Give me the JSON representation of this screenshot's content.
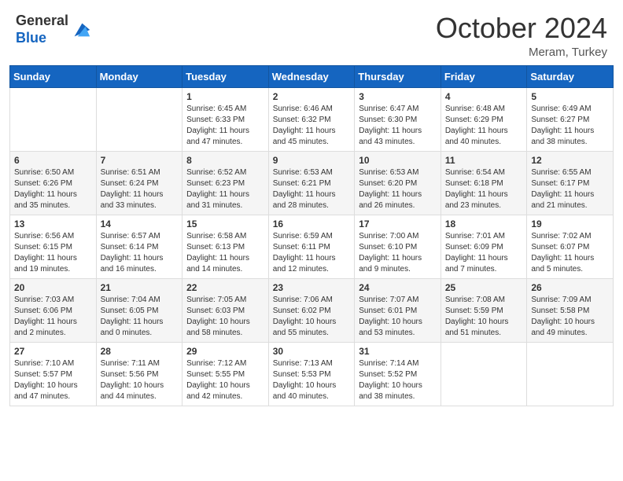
{
  "logo": {
    "line1": "General",
    "line2": "Blue"
  },
  "header": {
    "month": "October 2024",
    "location": "Meram, Turkey"
  },
  "weekdays": [
    "Sunday",
    "Monday",
    "Tuesday",
    "Wednesday",
    "Thursday",
    "Friday",
    "Saturday"
  ],
  "weeks": [
    [
      {
        "day": "",
        "info": ""
      },
      {
        "day": "",
        "info": ""
      },
      {
        "day": "1",
        "info": "Sunrise: 6:45 AM\nSunset: 6:33 PM\nDaylight: 11 hours and 47 minutes."
      },
      {
        "day": "2",
        "info": "Sunrise: 6:46 AM\nSunset: 6:32 PM\nDaylight: 11 hours and 45 minutes."
      },
      {
        "day": "3",
        "info": "Sunrise: 6:47 AM\nSunset: 6:30 PM\nDaylight: 11 hours and 43 minutes."
      },
      {
        "day": "4",
        "info": "Sunrise: 6:48 AM\nSunset: 6:29 PM\nDaylight: 11 hours and 40 minutes."
      },
      {
        "day": "5",
        "info": "Sunrise: 6:49 AM\nSunset: 6:27 PM\nDaylight: 11 hours and 38 minutes."
      }
    ],
    [
      {
        "day": "6",
        "info": "Sunrise: 6:50 AM\nSunset: 6:26 PM\nDaylight: 11 hours and 35 minutes."
      },
      {
        "day": "7",
        "info": "Sunrise: 6:51 AM\nSunset: 6:24 PM\nDaylight: 11 hours and 33 minutes."
      },
      {
        "day": "8",
        "info": "Sunrise: 6:52 AM\nSunset: 6:23 PM\nDaylight: 11 hours and 31 minutes."
      },
      {
        "day": "9",
        "info": "Sunrise: 6:53 AM\nSunset: 6:21 PM\nDaylight: 11 hours and 28 minutes."
      },
      {
        "day": "10",
        "info": "Sunrise: 6:53 AM\nSunset: 6:20 PM\nDaylight: 11 hours and 26 minutes."
      },
      {
        "day": "11",
        "info": "Sunrise: 6:54 AM\nSunset: 6:18 PM\nDaylight: 11 hours and 23 minutes."
      },
      {
        "day": "12",
        "info": "Sunrise: 6:55 AM\nSunset: 6:17 PM\nDaylight: 11 hours and 21 minutes."
      }
    ],
    [
      {
        "day": "13",
        "info": "Sunrise: 6:56 AM\nSunset: 6:15 PM\nDaylight: 11 hours and 19 minutes."
      },
      {
        "day": "14",
        "info": "Sunrise: 6:57 AM\nSunset: 6:14 PM\nDaylight: 11 hours and 16 minutes."
      },
      {
        "day": "15",
        "info": "Sunrise: 6:58 AM\nSunset: 6:13 PM\nDaylight: 11 hours and 14 minutes."
      },
      {
        "day": "16",
        "info": "Sunrise: 6:59 AM\nSunset: 6:11 PM\nDaylight: 11 hours and 12 minutes."
      },
      {
        "day": "17",
        "info": "Sunrise: 7:00 AM\nSunset: 6:10 PM\nDaylight: 11 hours and 9 minutes."
      },
      {
        "day": "18",
        "info": "Sunrise: 7:01 AM\nSunset: 6:09 PM\nDaylight: 11 hours and 7 minutes."
      },
      {
        "day": "19",
        "info": "Sunrise: 7:02 AM\nSunset: 6:07 PM\nDaylight: 11 hours and 5 minutes."
      }
    ],
    [
      {
        "day": "20",
        "info": "Sunrise: 7:03 AM\nSunset: 6:06 PM\nDaylight: 11 hours and 2 minutes."
      },
      {
        "day": "21",
        "info": "Sunrise: 7:04 AM\nSunset: 6:05 PM\nDaylight: 11 hours and 0 minutes."
      },
      {
        "day": "22",
        "info": "Sunrise: 7:05 AM\nSunset: 6:03 PM\nDaylight: 10 hours and 58 minutes."
      },
      {
        "day": "23",
        "info": "Sunrise: 7:06 AM\nSunset: 6:02 PM\nDaylight: 10 hours and 55 minutes."
      },
      {
        "day": "24",
        "info": "Sunrise: 7:07 AM\nSunset: 6:01 PM\nDaylight: 10 hours and 53 minutes."
      },
      {
        "day": "25",
        "info": "Sunrise: 7:08 AM\nSunset: 5:59 PM\nDaylight: 10 hours and 51 minutes."
      },
      {
        "day": "26",
        "info": "Sunrise: 7:09 AM\nSunset: 5:58 PM\nDaylight: 10 hours and 49 minutes."
      }
    ],
    [
      {
        "day": "27",
        "info": "Sunrise: 7:10 AM\nSunset: 5:57 PM\nDaylight: 10 hours and 47 minutes."
      },
      {
        "day": "28",
        "info": "Sunrise: 7:11 AM\nSunset: 5:56 PM\nDaylight: 10 hours and 44 minutes."
      },
      {
        "day": "29",
        "info": "Sunrise: 7:12 AM\nSunset: 5:55 PM\nDaylight: 10 hours and 42 minutes."
      },
      {
        "day": "30",
        "info": "Sunrise: 7:13 AM\nSunset: 5:53 PM\nDaylight: 10 hours and 40 minutes."
      },
      {
        "day": "31",
        "info": "Sunrise: 7:14 AM\nSunset: 5:52 PM\nDaylight: 10 hours and 38 minutes."
      },
      {
        "day": "",
        "info": ""
      },
      {
        "day": "",
        "info": ""
      }
    ]
  ]
}
